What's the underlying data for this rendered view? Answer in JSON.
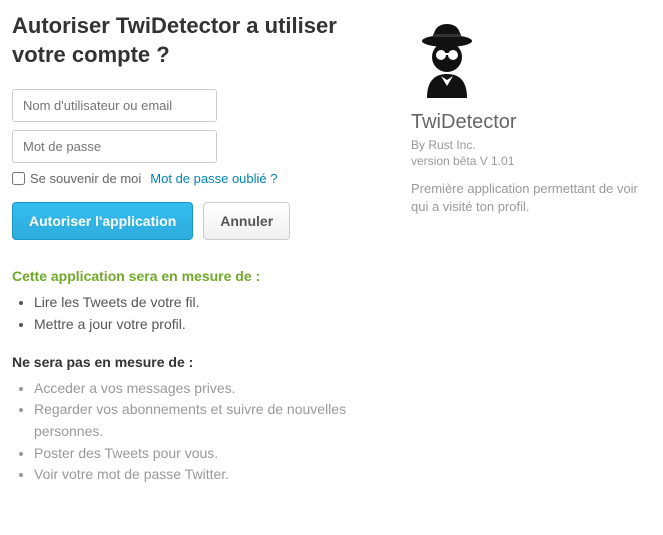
{
  "heading": "Autoriser TwiDetector a utiliser votre compte ?",
  "form": {
    "username_placeholder": "Nom d'utilisateur ou email",
    "password_placeholder": "Mot de passe",
    "remember_label": "Se souvenir de moi",
    "forgot_label": "Mot de passe oublié ?"
  },
  "buttons": {
    "authorize": "Autoriser l'application",
    "cancel": "Annuler"
  },
  "permissions": {
    "can_title": "Cette application sera en mesure de :",
    "can": [
      "Lire les Tweets de votre fil.",
      "Mettre a jour votre profil."
    ],
    "cannot_title": "Ne sera pas en mesure de :",
    "cannot": [
      "Acceder a vos messages prives.",
      "Regarder vos abonnements et suivre de nouvelles personnes.",
      "Poster des Tweets pour vous.",
      "Voir votre mot de passe Twitter."
    ]
  },
  "app": {
    "name": "TwiDetector",
    "by": "By Rust Inc.",
    "version": "version bêta V 1.01",
    "description": "Première application permettant de voir qui a visité ton profil."
  }
}
